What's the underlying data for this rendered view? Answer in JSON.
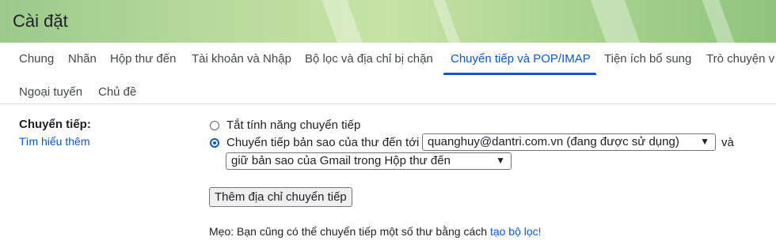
{
  "header": {
    "title": "Cài đặt"
  },
  "tabs": [
    {
      "label": "Chung"
    },
    {
      "label": "Nhãn"
    },
    {
      "label": "Hộp thư đến"
    },
    {
      "label": "Tài khoản và Nhập"
    },
    {
      "label": "Bộ lọc và địa chỉ bị chặn"
    },
    {
      "label": "Chuyển tiếp và POP/IMAP",
      "active": true
    },
    {
      "label": "Tiện ích bổ sung"
    },
    {
      "label": "Trò chuyện v"
    },
    {
      "label": "Ngoại tuyến"
    },
    {
      "label": "Chủ đề"
    }
  ],
  "forwarding": {
    "label": "Chuyển tiếp:",
    "learn_more": "Tìm hiểu thêm",
    "option_off": "Tắt tính năng chuyển tiếp",
    "option_on": "Chuyển tiếp bản sao của thư đến tới",
    "address_select": "quanghuy@dantri.com.vn (đang được sử dụng)",
    "and": "và",
    "action_select": "giữ bản sao của Gmail trong Hộp thư đến",
    "add_button": "Thêm địa chỉ chuyển tiếp",
    "tip_prefix": "Mẹo: Bạn cũng có thể chuyển tiếp một số thư bằng cách",
    "tip_link": "tạo bộ lọc!"
  },
  "colors": {
    "accent": "#0b57d0",
    "text": "#202124"
  }
}
